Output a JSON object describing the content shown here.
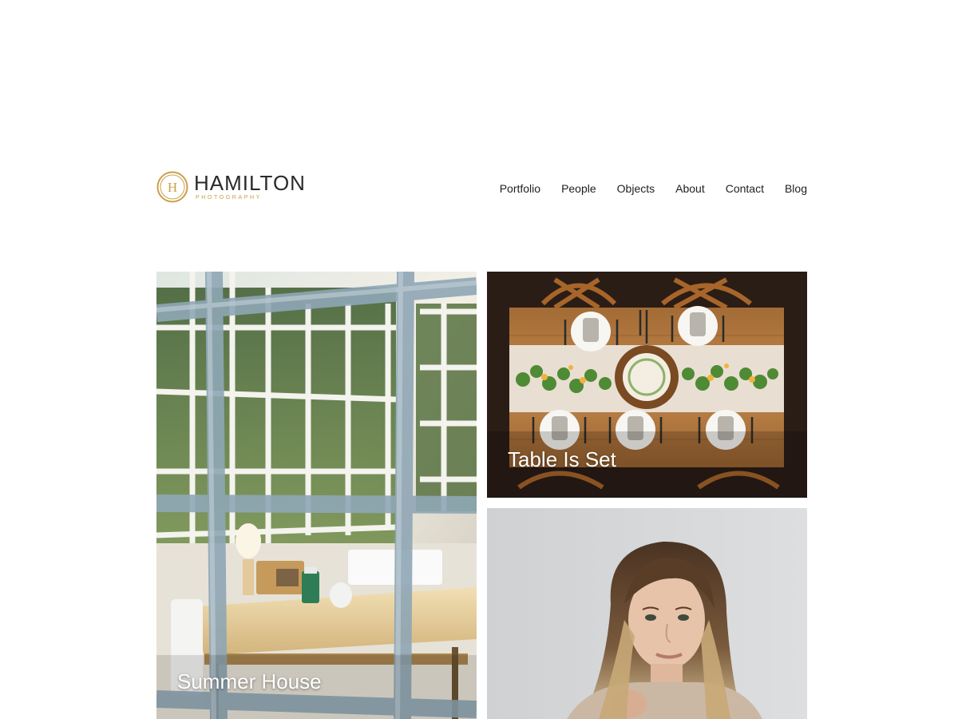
{
  "brand": {
    "name": "HAMILTON",
    "tagline": "PHOTOGRAPHY",
    "monogram": "H",
    "accent_color": "#c9a04a"
  },
  "nav": {
    "items": [
      {
        "label": "Portfolio"
      },
      {
        "label": "People"
      },
      {
        "label": "Objects"
      },
      {
        "label": "About"
      },
      {
        "label": "Contact"
      },
      {
        "label": "Blog"
      }
    ]
  },
  "gallery": {
    "items": [
      {
        "title": "Summer House",
        "image": "sunroom-interior-photo"
      },
      {
        "title": "Table Is Set",
        "image": "dinner-table-overhead-photo"
      },
      {
        "title": "",
        "image": "woman-portrait-photo"
      }
    ]
  }
}
